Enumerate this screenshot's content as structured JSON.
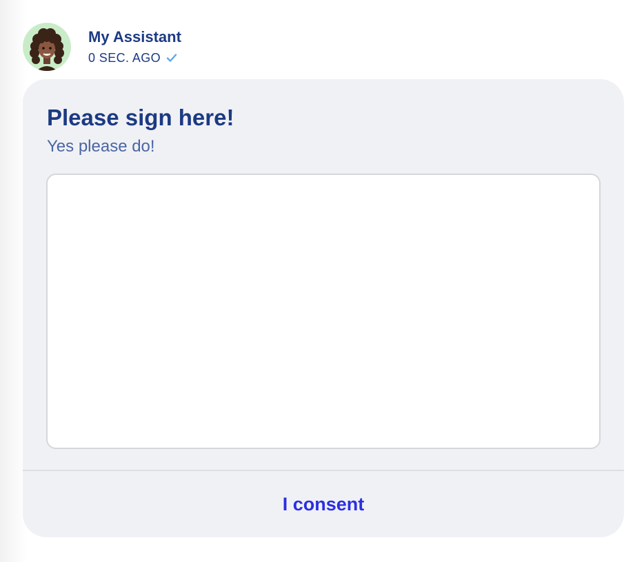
{
  "message": {
    "sender_name": "My Assistant",
    "timestamp": "0 SEC. AGO",
    "status_icon": "check-icon",
    "avatar_icon": "memoji-avatar"
  },
  "card": {
    "title": "Please sign here!",
    "subtitle": "Yes please do!",
    "signature_pad": {
      "value": ""
    },
    "consent_button_label": "I consent"
  },
  "colors": {
    "title": "#1c3a83",
    "subtitle": "#4a65a4",
    "card_background": "#f0f1f5",
    "button_text": "#2b2fe0",
    "check": "#5aa9ef",
    "avatar_background": "#c9ecc8"
  }
}
